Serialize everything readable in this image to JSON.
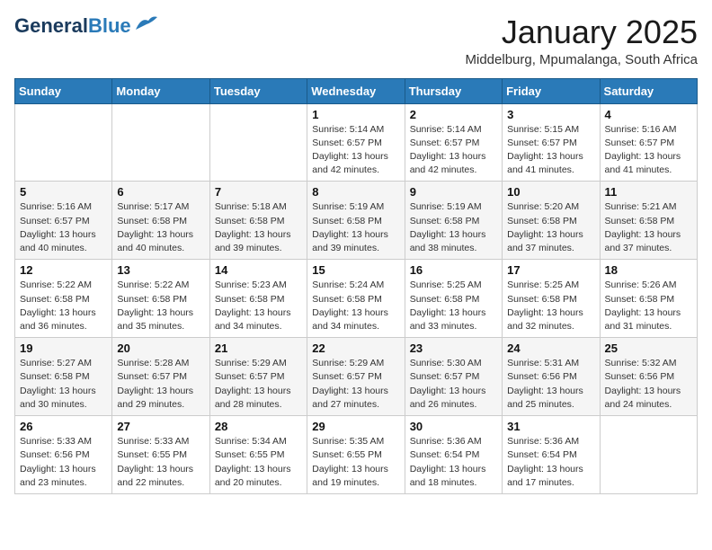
{
  "header": {
    "logo_general": "General",
    "logo_blue": "Blue",
    "month_title": "January 2025",
    "location": "Middelburg, Mpumalanga, South Africa"
  },
  "weekdays": [
    "Sunday",
    "Monday",
    "Tuesday",
    "Wednesday",
    "Thursday",
    "Friday",
    "Saturday"
  ],
  "weeks": [
    [
      {
        "day": "",
        "info": ""
      },
      {
        "day": "",
        "info": ""
      },
      {
        "day": "",
        "info": ""
      },
      {
        "day": "1",
        "info": "Sunrise: 5:14 AM\nSunset: 6:57 PM\nDaylight: 13 hours\nand 42 minutes."
      },
      {
        "day": "2",
        "info": "Sunrise: 5:14 AM\nSunset: 6:57 PM\nDaylight: 13 hours\nand 42 minutes."
      },
      {
        "day": "3",
        "info": "Sunrise: 5:15 AM\nSunset: 6:57 PM\nDaylight: 13 hours\nand 41 minutes."
      },
      {
        "day": "4",
        "info": "Sunrise: 5:16 AM\nSunset: 6:57 PM\nDaylight: 13 hours\nand 41 minutes."
      }
    ],
    [
      {
        "day": "5",
        "info": "Sunrise: 5:16 AM\nSunset: 6:57 PM\nDaylight: 13 hours\nand 40 minutes."
      },
      {
        "day": "6",
        "info": "Sunrise: 5:17 AM\nSunset: 6:58 PM\nDaylight: 13 hours\nand 40 minutes."
      },
      {
        "day": "7",
        "info": "Sunrise: 5:18 AM\nSunset: 6:58 PM\nDaylight: 13 hours\nand 39 minutes."
      },
      {
        "day": "8",
        "info": "Sunrise: 5:19 AM\nSunset: 6:58 PM\nDaylight: 13 hours\nand 39 minutes."
      },
      {
        "day": "9",
        "info": "Sunrise: 5:19 AM\nSunset: 6:58 PM\nDaylight: 13 hours\nand 38 minutes."
      },
      {
        "day": "10",
        "info": "Sunrise: 5:20 AM\nSunset: 6:58 PM\nDaylight: 13 hours\nand 37 minutes."
      },
      {
        "day": "11",
        "info": "Sunrise: 5:21 AM\nSunset: 6:58 PM\nDaylight: 13 hours\nand 37 minutes."
      }
    ],
    [
      {
        "day": "12",
        "info": "Sunrise: 5:22 AM\nSunset: 6:58 PM\nDaylight: 13 hours\nand 36 minutes."
      },
      {
        "day": "13",
        "info": "Sunrise: 5:22 AM\nSunset: 6:58 PM\nDaylight: 13 hours\nand 35 minutes."
      },
      {
        "day": "14",
        "info": "Sunrise: 5:23 AM\nSunset: 6:58 PM\nDaylight: 13 hours\nand 34 minutes."
      },
      {
        "day": "15",
        "info": "Sunrise: 5:24 AM\nSunset: 6:58 PM\nDaylight: 13 hours\nand 34 minutes."
      },
      {
        "day": "16",
        "info": "Sunrise: 5:25 AM\nSunset: 6:58 PM\nDaylight: 13 hours\nand 33 minutes."
      },
      {
        "day": "17",
        "info": "Sunrise: 5:25 AM\nSunset: 6:58 PM\nDaylight: 13 hours\nand 32 minutes."
      },
      {
        "day": "18",
        "info": "Sunrise: 5:26 AM\nSunset: 6:58 PM\nDaylight: 13 hours\nand 31 minutes."
      }
    ],
    [
      {
        "day": "19",
        "info": "Sunrise: 5:27 AM\nSunset: 6:58 PM\nDaylight: 13 hours\nand 30 minutes."
      },
      {
        "day": "20",
        "info": "Sunrise: 5:28 AM\nSunset: 6:57 PM\nDaylight: 13 hours\nand 29 minutes."
      },
      {
        "day": "21",
        "info": "Sunrise: 5:29 AM\nSunset: 6:57 PM\nDaylight: 13 hours\nand 28 minutes."
      },
      {
        "day": "22",
        "info": "Sunrise: 5:29 AM\nSunset: 6:57 PM\nDaylight: 13 hours\nand 27 minutes."
      },
      {
        "day": "23",
        "info": "Sunrise: 5:30 AM\nSunset: 6:57 PM\nDaylight: 13 hours\nand 26 minutes."
      },
      {
        "day": "24",
        "info": "Sunrise: 5:31 AM\nSunset: 6:56 PM\nDaylight: 13 hours\nand 25 minutes."
      },
      {
        "day": "25",
        "info": "Sunrise: 5:32 AM\nSunset: 6:56 PM\nDaylight: 13 hours\nand 24 minutes."
      }
    ],
    [
      {
        "day": "26",
        "info": "Sunrise: 5:33 AM\nSunset: 6:56 PM\nDaylight: 13 hours\nand 23 minutes."
      },
      {
        "day": "27",
        "info": "Sunrise: 5:33 AM\nSunset: 6:55 PM\nDaylight: 13 hours\nand 22 minutes."
      },
      {
        "day": "28",
        "info": "Sunrise: 5:34 AM\nSunset: 6:55 PM\nDaylight: 13 hours\nand 20 minutes."
      },
      {
        "day": "29",
        "info": "Sunrise: 5:35 AM\nSunset: 6:55 PM\nDaylight: 13 hours\nand 19 minutes."
      },
      {
        "day": "30",
        "info": "Sunrise: 5:36 AM\nSunset: 6:54 PM\nDaylight: 13 hours\nand 18 minutes."
      },
      {
        "day": "31",
        "info": "Sunrise: 5:36 AM\nSunset: 6:54 PM\nDaylight: 13 hours\nand 17 minutes."
      },
      {
        "day": "",
        "info": ""
      }
    ]
  ]
}
